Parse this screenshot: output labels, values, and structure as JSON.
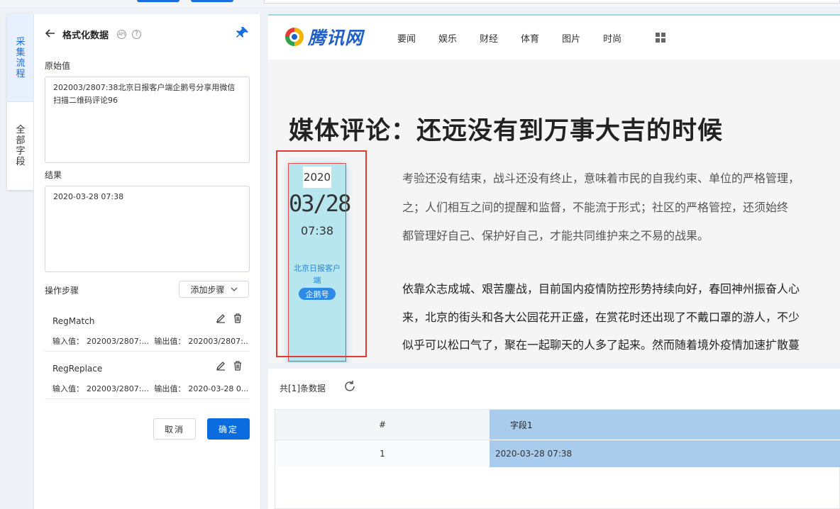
{
  "vtabs": [
    {
      "label": "采集流程"
    },
    {
      "label": "全部字段"
    }
  ],
  "panel": {
    "title": "格式化数据",
    "api_badge": "API",
    "help_badge": "?",
    "raw_label": "原始值",
    "raw_value": "202003/2807:38北京日报客户端企鹅号分享用微信扫描二维码评论96",
    "result_label": "结果",
    "result_value": "2020-03-28 07:38",
    "steps_label": "操作步骤",
    "add_step": "添加步骤",
    "steps": [
      {
        "name": "RegMatch",
        "input_label": "输入值：",
        "input": "202003/2807:...",
        "output_label": "输出值：",
        "output": "202003/2807:..."
      },
      {
        "name": "RegReplace",
        "input_label": "输入值：",
        "input": "202003/2807:...",
        "output_label": "输出值：",
        "output": "2020-03-28 0..."
      }
    ],
    "cancel": "取消",
    "confirm": "确定"
  },
  "web": {
    "logo_text": "腾讯网",
    "nav": [
      "要闻",
      "娱乐",
      "财经",
      "体育",
      "图片",
      "时尚"
    ],
    "headline": "媒体评论：还远没有到万事大吉的时候",
    "date": {
      "year": "2020",
      "md": "03/28",
      "time": "07:38",
      "source": "北京日报客户端",
      "badge": "企鹅号"
    },
    "paragraphs": [
      "考验还没有结束，战斗还没有终止，意味着市民的自我约束、单位的严格管理，",
      "之；人们相互之间的提醒和监督，不能流于形式；社区的严格管控，还须始终",
      "都管理好自己、保护好自己，才能共同维护来之不易的战果。",
      "依靠众志成城、艰苦鏖战，目前国内疫情防控形势持续向好，春回神州振奋人心",
      "来，北京的街头和各大公园花开正盛，在赏花时还出现了不戴口罩的游人，不少",
      "似乎可以松口气了，聚在一起聊天的人多了起来。然而随着境外疫情加速扩散蔓"
    ]
  },
  "results": {
    "count": "共[1]条数据",
    "columns": [
      "#",
      "字段1"
    ],
    "rows": [
      {
        "idx": "1",
        "field1": "2020-03-28 07:38"
      }
    ]
  }
}
